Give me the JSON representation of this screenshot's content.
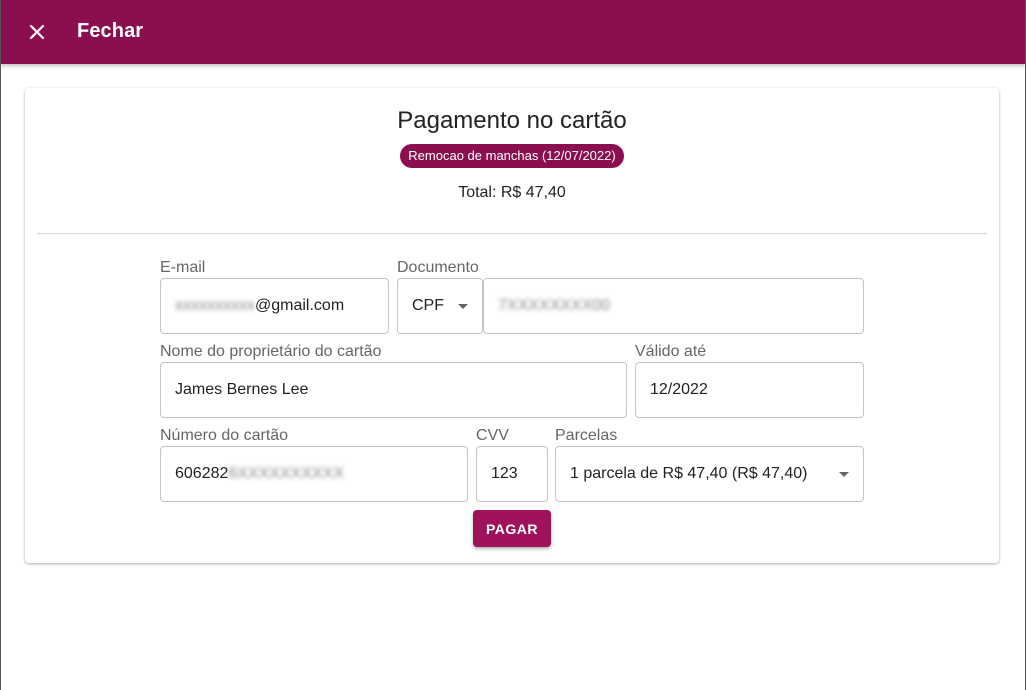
{
  "header": {
    "close_icon": "close-icon",
    "title": "Fechar",
    "bar_color": "#8b0f4f"
  },
  "card": {
    "title": "Pagamento no cartão",
    "service_chip": "Remocao de manchas (12/07/2022)",
    "total": "Total: R$ 47,40"
  },
  "form": {
    "email": {
      "label": "E-mail",
      "value_prefix_blurred": "xxxxxxxxxx",
      "value_suffix": "@gmail.com"
    },
    "document": {
      "label": "Documento",
      "type_selected": "CPF",
      "number_blurred": "7XXXXXXXX00"
    },
    "owner_name": {
      "label": "Nome do proprietário do cartão",
      "value": "James Bernes Lee"
    },
    "valid_until": {
      "label": "Válido até",
      "value": "12/2022"
    },
    "card_number": {
      "label": "Número do cartão",
      "value_prefix": "606282",
      "value_blurred": "6XXXXXXXXXX"
    },
    "cvv": {
      "label": "CVV",
      "value": "123"
    },
    "installments": {
      "label": "Parcelas",
      "selected": "1 parcela de R$ 47,40 (R$ 47,40)"
    },
    "pay_button": "PAGAR"
  },
  "colors": {
    "primary": "#8b0f4f",
    "button": "#a0135a"
  }
}
